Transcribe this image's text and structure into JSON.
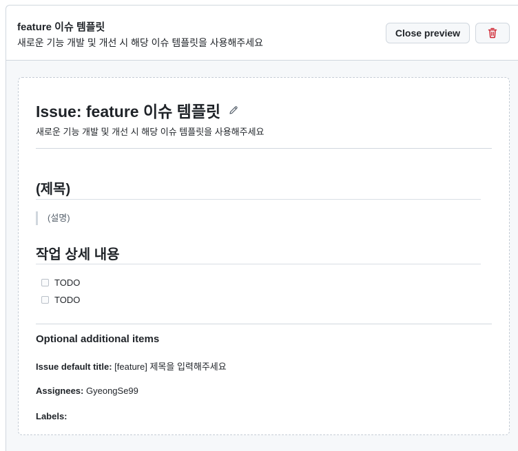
{
  "header": {
    "title": "feature 이슈 템플릿",
    "description": "새로운 기능 개발 및 개선 시 해당 이슈 템플릿을 사용해주세요",
    "close_preview_label": "Close preview",
    "delete_icon": "trash-icon"
  },
  "preview": {
    "title": "Issue: feature 이슈 템플릿",
    "edit_icon": "pencil-icon",
    "description": "새로운 기능 개발 및 개선 시 해당 이슈 템플릿을 사용해주세요",
    "body": {
      "heading1": "(제목)",
      "quote": "(설명)",
      "heading2": "작업 상세 내용",
      "tasks": [
        {
          "label": "TODO",
          "checked": false
        },
        {
          "label": "TODO",
          "checked": false
        }
      ]
    },
    "optional": {
      "title": "Optional additional items",
      "default_title_label": "Issue default title:",
      "default_title_value": "[feature] 제목을 입력해주세요",
      "assignees_label": "Assignees:",
      "assignees_value": "GyeongSe99",
      "labels_label": "Labels:",
      "labels_value": ""
    }
  },
  "colors": {
    "delete_red": "#cf222e",
    "border": "#d0d7de",
    "text": "#1f2328"
  }
}
